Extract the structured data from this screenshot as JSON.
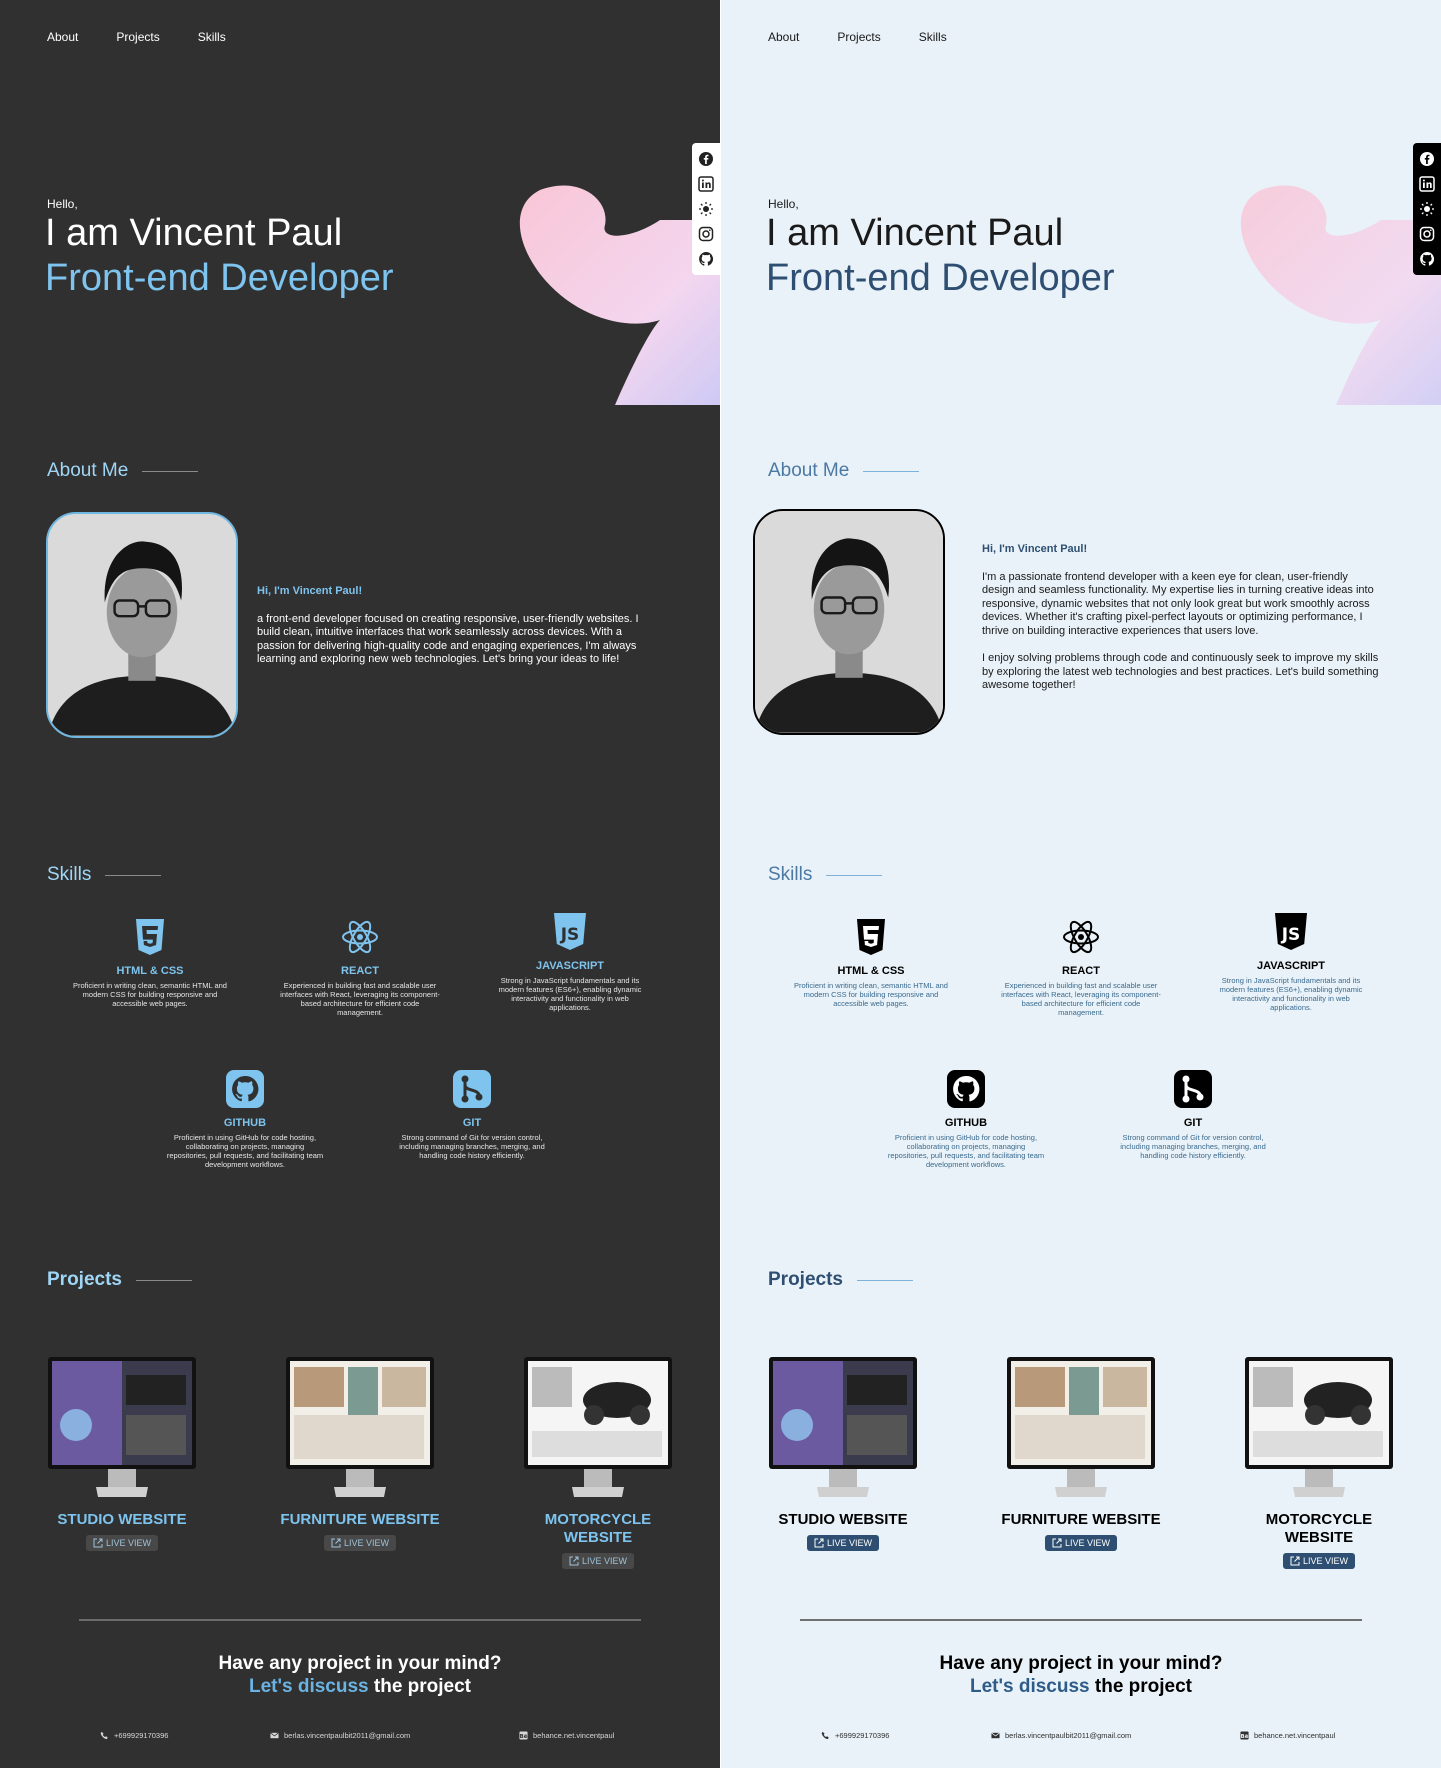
{
  "nav": [
    "About",
    "Projects",
    "Skills"
  ],
  "social_icons": [
    "facebook-icon",
    "linkedin-icon",
    "theme-toggle-icon",
    "instagram-icon",
    "github-icon"
  ],
  "hero": {
    "hello": "Hello,",
    "name": "I am Vincent Paul",
    "role": "Front-end Developer"
  },
  "sections": {
    "about": "About Me",
    "skills": "Skills",
    "projects": "Projects"
  },
  "about_dark": {
    "greeting": "Hi, I'm Vincent Paul!",
    "paragraphs": [
      " a front-end developer focused on creating responsive, user-friendly websites. I build clean, intuitive interfaces that work seamlessly across devices. With a passion for delivering high-quality code and engaging experiences, I'm always learning and exploring new web technologies. Let's bring your ideas to life!"
    ]
  },
  "about_light": {
    "greeting": "Hi, I'm Vincent Paul!",
    "paragraphs": [
      "I'm a passionate frontend developer with a keen eye for clean, user-friendly design and seamless functionality. My expertise lies in turning creative ideas into responsive, dynamic websites that not only look great but work smoothly across devices. Whether it's crafting pixel-perfect layouts or optimizing performance, I thrive on building interactive experiences that users love.",
      "I enjoy solving problems through code and continuously seek to improve my skills by exploring the latest web technologies and best practices. Let's build something awesome together!"
    ]
  },
  "skills": [
    {
      "icon": "html-css-icon",
      "name": "HTML & CSS",
      "desc": "Proficient in writing clean, semantic HTML and modern CSS for building responsive and accessible web pages."
    },
    {
      "icon": "react-icon",
      "name": "REACT",
      "desc": "Experienced in building fast and scalable user interfaces with React, leveraging its component-based architecture for efficient code management."
    },
    {
      "icon": "javascript-icon",
      "name": "JAVASCRIPT",
      "desc": "Strong in JavaScript fundamentals and its modern features (ES6+), enabling dynamic interactivity and functionality in web applications."
    },
    {
      "icon": "github-icon",
      "name": "GITHUB",
      "desc": "Proficient in using GitHub for code hosting, collaborating on projects, managing repositories, pull requests, and facilitating team development workflows."
    },
    {
      "icon": "git-icon",
      "name": "GIT",
      "desc": "Strong command of Git for version control, including managing branches, merging, and handling code history efficiently."
    }
  ],
  "projects": [
    {
      "name": "STUDIO WEBSITE",
      "live": "LIVE VIEW"
    },
    {
      "name": "FURNITURE WEBSITE",
      "live": "LIVE VIEW"
    },
    {
      "name": "MOTORCYCLE WEBSITE",
      "live": "LIVE VIEW"
    }
  ],
  "cta": {
    "line1": "Have any project in your mind?",
    "accent": "Let's discuss",
    "rest": " the project"
  },
  "contact": {
    "phone": "+699929170396",
    "email": "berlas.vincentpaulbit2011@gmail.com",
    "behance": "behance.net.vincentpaul"
  },
  "colors": {
    "dark_bg": "#303030",
    "light_bg": "#e9f2f8",
    "dark_accent": "#7ec4ee",
    "light_accent": "#2e4f72"
  }
}
